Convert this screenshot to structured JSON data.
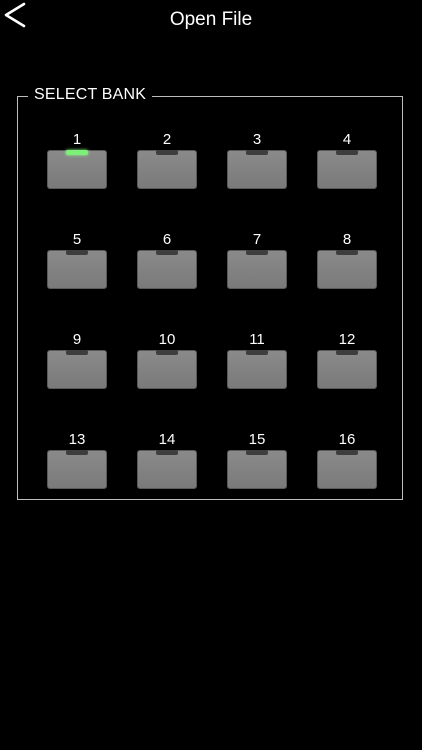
{
  "header": {
    "title": "Open File",
    "back_icon": "chevron-left-icon"
  },
  "bank_panel": {
    "legend": "SELECT BANK",
    "banks": [
      {
        "label": "1",
        "selected": true
      },
      {
        "label": "2",
        "selected": false
      },
      {
        "label": "3",
        "selected": false
      },
      {
        "label": "4",
        "selected": false
      },
      {
        "label": "5",
        "selected": false
      },
      {
        "label": "6",
        "selected": false
      },
      {
        "label": "7",
        "selected": false
      },
      {
        "label": "8",
        "selected": false
      },
      {
        "label": "9",
        "selected": false
      },
      {
        "label": "10",
        "selected": false
      },
      {
        "label": "11",
        "selected": false
      },
      {
        "label": "12",
        "selected": false
      },
      {
        "label": "13",
        "selected": false
      },
      {
        "label": "14",
        "selected": false
      },
      {
        "label": "15",
        "selected": false
      },
      {
        "label": "16",
        "selected": false
      }
    ]
  },
  "colors": {
    "background": "#000000",
    "indicator_selected": "#7ef07a",
    "indicator_idle": "#3e3e3e",
    "slot": "#808080"
  }
}
